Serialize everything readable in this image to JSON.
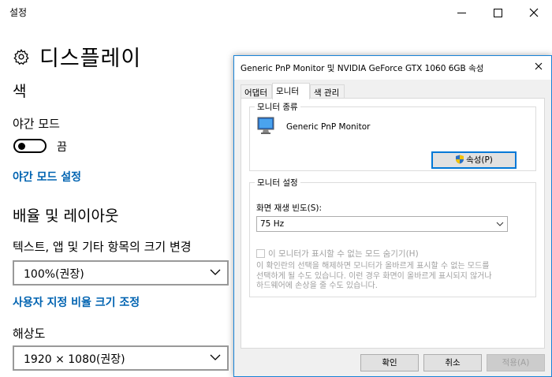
{
  "settings": {
    "window_title": "설정",
    "page_title": "디스플레이",
    "sections": {
      "color": "색",
      "scale_layout": "배율 및 레이아웃"
    },
    "night_mode": {
      "label": "야간 모드",
      "toggle_state": "끔",
      "settings_link": "야간 모드 설정"
    },
    "scale": {
      "label": "텍스트, 앱 및 기타 항목의 크기 변경",
      "value": "100%(권장)",
      "custom_link": "사용자 지정 비율 크기 조정"
    },
    "resolution": {
      "label": "해상도",
      "value": "1920 × 1080(권장)"
    }
  },
  "dialog": {
    "title": "Generic PnP Monitor 및 NVIDIA GeForce GTX 1060 6GB 속성",
    "tabs": [
      {
        "label": "어댑터",
        "active": false
      },
      {
        "label": "모니터",
        "active": true
      },
      {
        "label": "색 관리",
        "active": false
      }
    ],
    "monitor_type": {
      "group_title": "모니터 종류",
      "monitor_name": "Generic PnP Monitor",
      "properties_button": "속성(P)"
    },
    "monitor_settings": {
      "group_title": "모니터 설정",
      "refresh_label": "화면 재생 빈도(S):",
      "refresh_value": "75 Hz",
      "hide_modes_label": "이 모니터가 표시할 수 없는 모드 숨기기(H)",
      "hide_modes_checked": false,
      "help_text": "이 확인란의 선택을 해제하면 모니터가 올바르게 표시할 수 없는 모드를\n선택하게 될 수도 있습니다. 이런 경우 화면이 올바르게 표시되지 않거나\n하드웨어에 손상을 줄 수도 있습니다."
    },
    "buttons": {
      "ok": "확인",
      "cancel": "취소",
      "apply": "적용(A)"
    }
  },
  "colors": {
    "link": "#0063b1",
    "focus": "#0078d7",
    "disabled_text": "#a0a0a0"
  }
}
